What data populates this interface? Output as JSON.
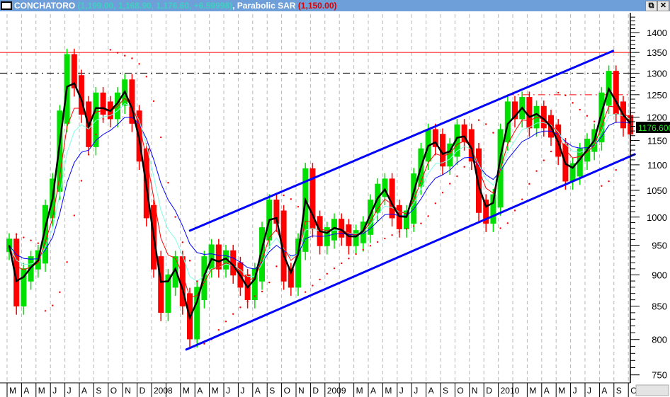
{
  "window": {
    "symbol": "CONCHATORO",
    "quote": "(1,199.00, 1,168.90, 1,176.60, +6.59998)",
    "indicator": "Parabolic SAR",
    "indicator_value": "(1,150.00)",
    "restore_icon": "restore-icon",
    "close_icon": "close-icon"
  },
  "chart_data": {
    "type": "line",
    "title": "CONCHATORO",
    "scale": "log",
    "ylim": [
      730,
      1440
    ],
    "yticks": [
      750,
      800,
      850,
      900,
      950,
      1000,
      1050,
      1100,
      1150,
      1200,
      1250,
      1300,
      1350,
      1400
    ],
    "ytick_labels": [
      "750",
      "800",
      "850",
      "900",
      "950",
      "1000",
      "1050",
      "1100",
      "1150",
      "1200",
      "1250",
      "1300",
      "1350",
      "1400"
    ],
    "last_price_label": "1176.600",
    "x_unit": "months since Mar 2007 (2 points per month)",
    "x_labels": [
      {
        "m": 0,
        "t": "M"
      },
      {
        "m": 1,
        "t": "A"
      },
      {
        "m": 2,
        "t": "M"
      },
      {
        "m": 3,
        "t": "J"
      },
      {
        "m": 4,
        "t": "J"
      },
      {
        "m": 5,
        "t": "A"
      },
      {
        "m": 6,
        "t": "S"
      },
      {
        "m": 7,
        "t": "O"
      },
      {
        "m": 8,
        "t": "N"
      },
      {
        "m": 9,
        "t": "D"
      },
      {
        "m": 10,
        "t": "2008"
      },
      {
        "m": 12,
        "t": "M"
      },
      {
        "m": 13,
        "t": "A"
      },
      {
        "m": 14,
        "t": "M"
      },
      {
        "m": 15,
        "t": "J"
      },
      {
        "m": 16,
        "t": "J"
      },
      {
        "m": 17,
        "t": "A"
      },
      {
        "m": 18,
        "t": "S"
      },
      {
        "m": 19,
        "t": "O"
      },
      {
        "m": 20,
        "t": "N"
      },
      {
        "m": 21,
        "t": "D"
      },
      {
        "m": 22,
        "t": "2009"
      },
      {
        "m": 24,
        "t": "M"
      },
      {
        "m": 25,
        "t": "A"
      },
      {
        "m": 26,
        "t": "M"
      },
      {
        "m": 27,
        "t": "J"
      },
      {
        "m": 28,
        "t": "J"
      },
      {
        "m": 29,
        "t": "A"
      },
      {
        "m": 30,
        "t": "S"
      },
      {
        "m": 31,
        "t": "O"
      },
      {
        "m": 32,
        "t": "N"
      },
      {
        "m": 33,
        "t": "D"
      },
      {
        "m": 34,
        "t": "2010"
      },
      {
        "m": 36,
        "t": "M"
      },
      {
        "m": 37,
        "t": "A"
      },
      {
        "m": 38,
        "t": "M"
      },
      {
        "m": 39,
        "t": "J"
      },
      {
        "m": 40,
        "t": "J"
      },
      {
        "m": 41,
        "t": "A"
      },
      {
        "m": 42,
        "t": "S"
      },
      {
        "m": 43,
        "t": "O"
      }
    ],
    "closes": [
      950,
      860,
      900,
      920,
      930,
      1010,
      1060,
      1200,
      1330,
      1280,
      1220,
      1150,
      1240,
      1220,
      1210,
      1240,
      1270,
      1200,
      1120,
      1010,
      920,
      850,
      890,
      920,
      860,
      810,
      870,
      920,
      940,
      920,
      930,
      910,
      890,
      870,
      900,
      970,
      1020,
      1000,
      900,
      890,
      950,
      1080,
      990,
      960,
      970,
      985,
      975,
      960,
      965,
      980,
      1020,
      1050,
      1060,
      1010,
      990,
      1000,
      1070,
      1120,
      1160,
      1150,
      1110,
      1130,
      1170,
      1160,
      1120,
      1020,
      1000,
      1030,
      1160,
      1220,
      1210,
      1230,
      1190,
      1210,
      1190,
      1170,
      1130,
      1080,
      1090,
      1120,
      1140,
      1160,
      1240,
      1290,
      1220,
      1190,
      1176.6
    ],
    "series_colors": {
      "up": "#00e000",
      "down": "#ff0000",
      "fast_ma": "#000000",
      "mid_ma": "#ff0000",
      "cyan_ma": "#7fffe0",
      "slow_ma": "#0000ff",
      "sar": "#ff0000"
    },
    "hlines": [
      {
        "price": 1350,
        "color": "#ff0000",
        "style": "solid",
        "from_m": -1
      },
      {
        "price": 1300,
        "color": "#000000",
        "style": "dashdot",
        "from_m": -1
      },
      {
        "price": 1250,
        "color": "#ff0000",
        "style": "dashdot",
        "from_m": 34.6
      }
    ],
    "trendlines": [
      {
        "m1": 12.6,
        "p1": 975,
        "m2": 42,
        "p2": 1355,
        "color": "#0000ff"
      },
      {
        "m1": 12.35,
        "p1": 785,
        "m2": 43.5,
        "p2": 1122,
        "color": "#0000ff"
      }
    ]
  }
}
